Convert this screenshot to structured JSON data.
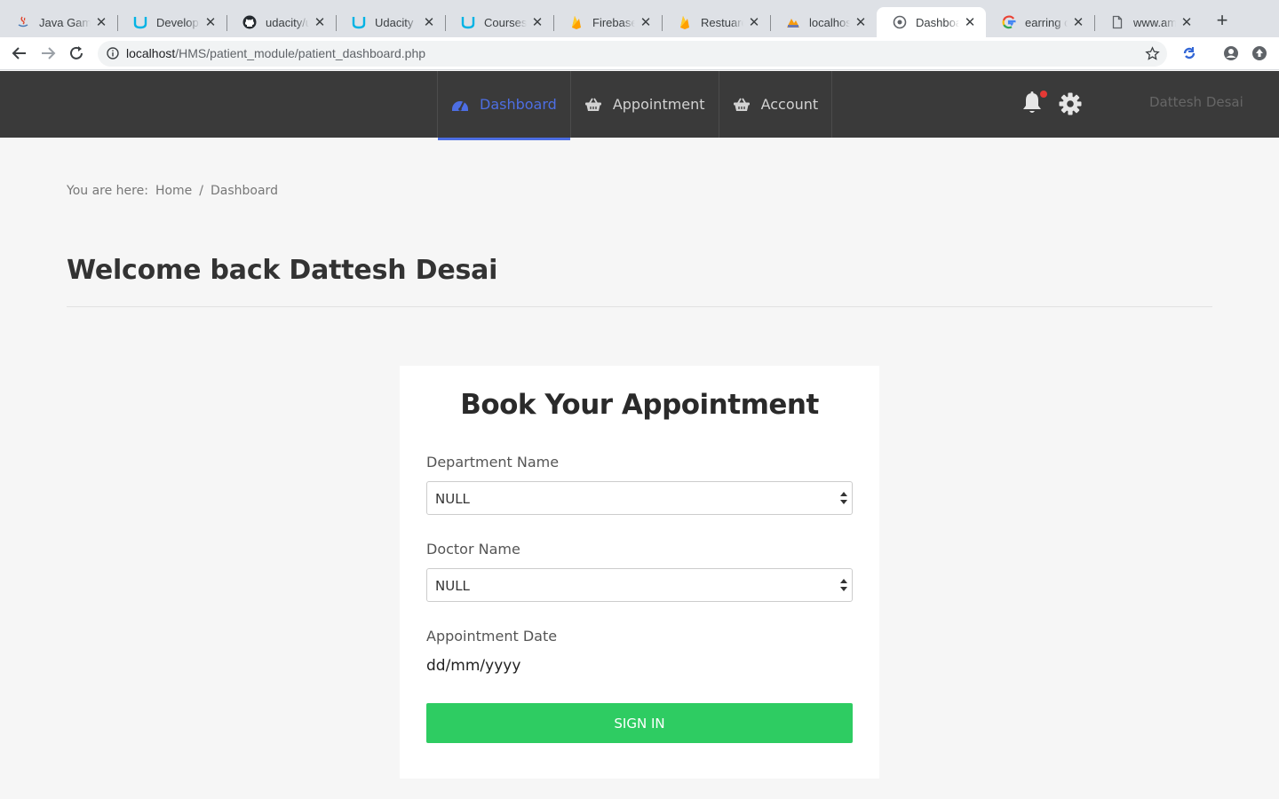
{
  "browser": {
    "tabs": [
      {
        "title": "Java Games",
        "icon": "java-icon"
      },
      {
        "title": "Developing",
        "icon": "udacity-icon"
      },
      {
        "title": "udacity/ud",
        "icon": "github-icon"
      },
      {
        "title": "Udacity",
        "icon": "udacity-icon"
      },
      {
        "title": "Courses |",
        "icon": "udacity-icon"
      },
      {
        "title": "Firebase",
        "icon": "firebase-icon"
      },
      {
        "title": "Restuarent",
        "icon": "firebase-icon"
      },
      {
        "title": "localhost /",
        "icon": "phpmyadmin-icon"
      },
      {
        "title": "Dashboard",
        "icon": "page-icon",
        "active": true
      },
      {
        "title": "earring on",
        "icon": "google-icon"
      },
      {
        "title": "www.ama",
        "icon": "document-icon"
      }
    ],
    "url_host": "localhost",
    "url_path": "/HMS/patient_module/patient_dashboard.php"
  },
  "header": {
    "nav": [
      {
        "label": "Dashboard",
        "icon": "dashboard-icon",
        "active": true
      },
      {
        "label": "Appointment",
        "icon": "basket-icon"
      },
      {
        "label": "Account",
        "icon": "basket-icon"
      }
    ],
    "user_name": "Dattesh Desai",
    "has_notification": true
  },
  "breadcrumb": {
    "prefix": "You are here:",
    "home": "Home",
    "separator": "/",
    "current": "Dashboard"
  },
  "welcome": "Welcome back Dattesh Desai",
  "form": {
    "title": "Book Your Appointment",
    "department_label": "Department Name",
    "department_value": "NULL",
    "doctor_label": "Doctor Name",
    "doctor_value": "NULL",
    "date_label": "Appointment Date",
    "date_placeholder": "dd/mm/yyyy",
    "submit_label": "SIGN IN"
  },
  "colors": {
    "header_bg": "#3a3a3a",
    "accent_blue": "#4d6ee3",
    "button_green": "#2ecc62",
    "notification_dot": "#e53935"
  }
}
